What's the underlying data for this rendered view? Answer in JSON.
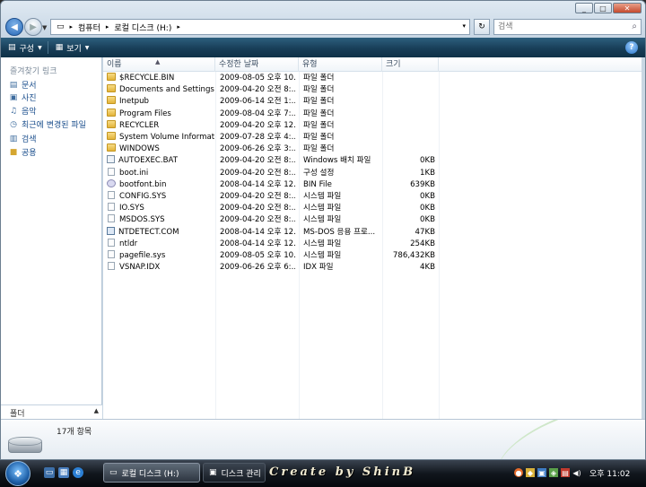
{
  "titlebar": {
    "min_label": "_",
    "max_label": "□",
    "close_label": "✕"
  },
  "nav": {
    "back_glyph": "◀",
    "forward_glyph": "▶",
    "recent_glyph": "▼",
    "refresh_glyph": "↻"
  },
  "address": {
    "crumbs": [
      "컴퓨터",
      "로컬 디스크 (H:)"
    ],
    "separator": "▸",
    "dropdown": "▾"
  },
  "search": {
    "placeholder": "검색",
    "icon": "search-icon"
  },
  "toolbar": {
    "organize_label": "구성",
    "views_label": "보기",
    "help_label": "?"
  },
  "favorites": {
    "title": "즐겨찾기 링크",
    "items": [
      {
        "label": "문서",
        "icon": "documents-icon"
      },
      {
        "label": "사진",
        "icon": "pictures-icon"
      },
      {
        "label": "음악",
        "icon": "music-icon"
      },
      {
        "label": "최근에 변경된 파일",
        "icon": "recent-icon"
      },
      {
        "label": "검색",
        "icon": "search-folder-icon"
      },
      {
        "label": "공용",
        "icon": "public-folder-icon"
      }
    ]
  },
  "folders_bar": {
    "label": "폴더",
    "chevron": "▲"
  },
  "columns": {
    "name": "이름",
    "date": "수정한 날짜",
    "type": "유형",
    "size": "크기",
    "sort_glyph": "▲"
  },
  "files": [
    {
      "name": "$RECYCLE.BIN",
      "date": "2009-08-05 오후 10...",
      "type": "파일 폴더",
      "size": "",
      "icon": "folder"
    },
    {
      "name": "Documents and Settings",
      "date": "2009-04-20 오전 8:...",
      "type": "파일 폴더",
      "size": "",
      "icon": "folder"
    },
    {
      "name": "Inetpub",
      "date": "2009-06-14 오전 1:...",
      "type": "파일 폴더",
      "size": "",
      "icon": "folder"
    },
    {
      "name": "Program Files",
      "date": "2009-08-04 오후 7:...",
      "type": "파일 폴더",
      "size": "",
      "icon": "folder"
    },
    {
      "name": "RECYCLER",
      "date": "2009-04-20 오후 12...",
      "type": "파일 폴더",
      "size": "",
      "icon": "folder"
    },
    {
      "name": "System Volume Informati...",
      "date": "2009-07-28 오후 4:...",
      "type": "파일 폴더",
      "size": "",
      "icon": "folder"
    },
    {
      "name": "WINDOWS",
      "date": "2009-06-26 오후 3:...",
      "type": "파일 폴더",
      "size": "",
      "icon": "folder"
    },
    {
      "name": "AUTOEXEC.BAT",
      "date": "2009-04-20 오전 8:...",
      "type": "Windows 배치 파일",
      "size": "0KB",
      "icon": "bat"
    },
    {
      "name": "boot.ini",
      "date": "2009-04-20 오전 8:...",
      "type": "구성 설정",
      "size": "1KB",
      "icon": "file"
    },
    {
      "name": "bootfont.bin",
      "date": "2008-04-14 오후 12...",
      "type": "BIN File",
      "size": "639KB",
      "icon": "font"
    },
    {
      "name": "CONFIG.SYS",
      "date": "2009-04-20 오전 8:...",
      "type": "시스템 파일",
      "size": "0KB",
      "icon": "file"
    },
    {
      "name": "IO.SYS",
      "date": "2009-04-20 오전 8:...",
      "type": "시스템 파일",
      "size": "0KB",
      "icon": "file"
    },
    {
      "name": "MSDOS.SYS",
      "date": "2009-04-20 오전 8:...",
      "type": "시스템 파일",
      "size": "0KB",
      "icon": "file"
    },
    {
      "name": "NTDETECT.COM",
      "date": "2008-04-14 오후 12...",
      "type": "MS-DOS 응용 프로...",
      "size": "47KB",
      "icon": "app"
    },
    {
      "name": "ntldr",
      "date": "2008-04-14 오후 12...",
      "type": "시스템 파일",
      "size": "254KB",
      "icon": "file"
    },
    {
      "name": "pagefile.sys",
      "date": "2009-08-05 오후 10...",
      "type": "시스템 파일",
      "size": "786,432KB",
      "icon": "file"
    },
    {
      "name": "VSNAP.IDX",
      "date": "2009-06-26 오후 6:...",
      "type": "IDX 파일",
      "size": "4KB",
      "icon": "file"
    }
  ],
  "details": {
    "item_count": "17개 항목"
  },
  "taskbar": {
    "start_glyph": "❖",
    "tasks": [
      {
        "label": "로컬 디스크 (H:)",
        "icon": "drive-icon"
      },
      {
        "label": "디스크 관리",
        "icon": "disk-management-icon"
      }
    ],
    "watermark": "Create by ShinB",
    "clock": "오후 11:02"
  }
}
